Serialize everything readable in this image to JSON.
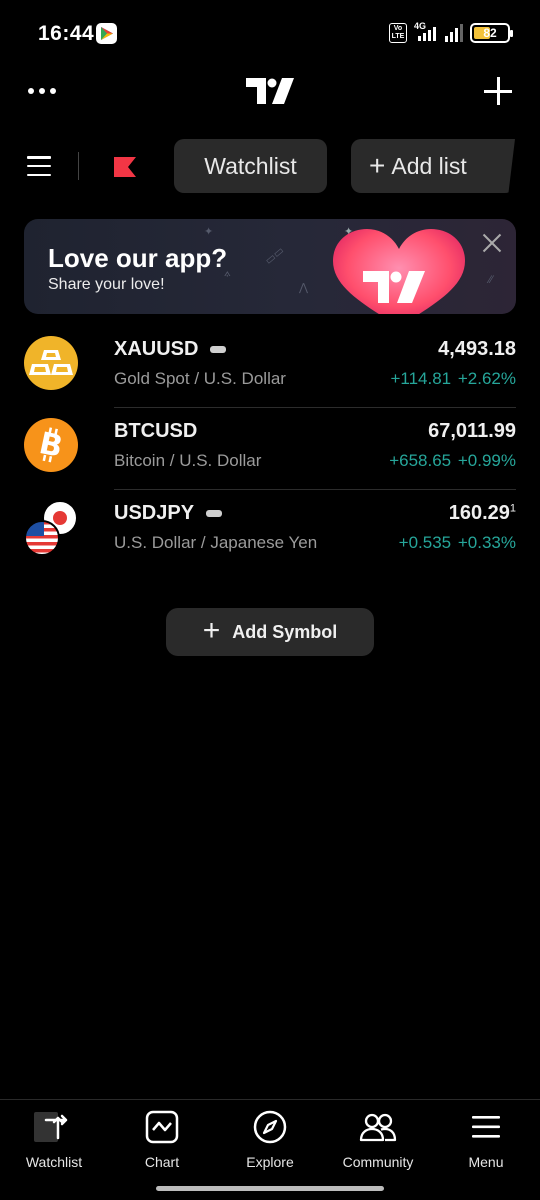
{
  "status_bar": {
    "time": "16:44",
    "volte_label": "Vo\nLTE",
    "network_label": "4G",
    "battery_level": "82"
  },
  "header": {
    "more_icon": "more-dots-icon",
    "logo_icon": "tradingview-logo-icon",
    "add_icon": "plus-icon"
  },
  "toolbar": {
    "menu_icon": "hamburger-icon",
    "flag_icon": "red-flag-icon",
    "watchlist_label": "Watchlist",
    "add_list_label": "Add list",
    "add_list_plus": "+"
  },
  "banner": {
    "title": "Love our app?",
    "subtitle": "Share your love!",
    "close_icon": "close-icon",
    "heart_color": "#ff4f6d"
  },
  "symbols": [
    {
      "ticker": "XAUUSD",
      "description": "Gold Spot / U.S. Dollar",
      "price": "4,493.18",
      "price_sup": "",
      "change": "+114.81",
      "change_pct": "+2.62%",
      "icon": "gold-bars-icon"
    },
    {
      "ticker": "BTCUSD",
      "description": "Bitcoin / U.S. Dollar",
      "price": "67,011.99",
      "price_sup": "",
      "change": "+658.65",
      "change_pct": "+0.99%",
      "icon": "bitcoin-icon"
    },
    {
      "ticker": "USDJPY",
      "description": "U.S. Dollar / Japanese Yen",
      "price": "160.29",
      "price_sup": "1",
      "change": "+0.535",
      "change_pct": "+0.33%",
      "icon": "us-japan-flags-icon"
    }
  ],
  "add_symbol": {
    "plus": "+",
    "label": "Add Symbol"
  },
  "bottom_nav": [
    {
      "label": "Watchlist",
      "icon": "watchlist-icon",
      "active": true
    },
    {
      "label": "Chart",
      "icon": "chart-icon",
      "active": false
    },
    {
      "label": "Explore",
      "icon": "compass-icon",
      "active": false
    },
    {
      "label": "Community",
      "icon": "people-icon",
      "active": false
    },
    {
      "label": "Menu",
      "icon": "menu-icon",
      "active": false
    }
  ],
  "colors": {
    "background": "#000000",
    "positive": "#26a69a",
    "pill": "#2a2a2a",
    "gold": "#f0b429",
    "bitcoin": "#f7931a"
  }
}
